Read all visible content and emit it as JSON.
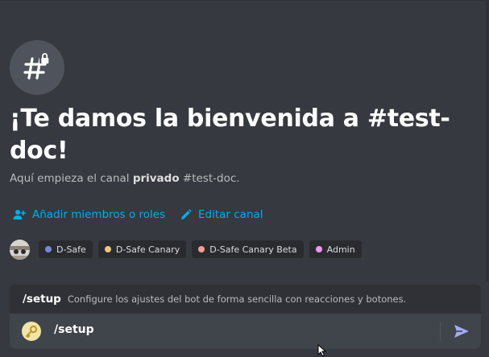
{
  "welcome": {
    "title": "¡Te damos la bienvenida a #test-doc!",
    "subtitle_pre": "Aquí empieza el canal ",
    "subtitle_strong": "privado",
    "subtitle_post": " #test-doc."
  },
  "actions": {
    "add_members": "Añadir miembros o roles",
    "edit_channel": "Editar canal"
  },
  "roles": [
    {
      "name": "D-Safe",
      "color": "#7289da"
    },
    {
      "name": "D-Safe Canary",
      "color": "#f1c57a"
    },
    {
      "name": "D-Safe Canary Beta",
      "color": "#f79c92"
    },
    {
      "name": "Admin",
      "color": "#f494f0"
    }
  ],
  "command_suggestion": {
    "name": "/setup",
    "description": "Configure los ajustes del bot de forma sencilla con reacciones y botones."
  },
  "input": {
    "value": "/setup"
  },
  "icons": {
    "channel": "hashtag-lock-icon",
    "add_members": "add-user-icon",
    "edit_channel": "pencil-icon",
    "command_bot": "key-icon",
    "send": "send-icon"
  },
  "colors": {
    "background": "#36393f",
    "link": "#00aff4",
    "panel": "#2f3136",
    "input": "#40444b"
  }
}
